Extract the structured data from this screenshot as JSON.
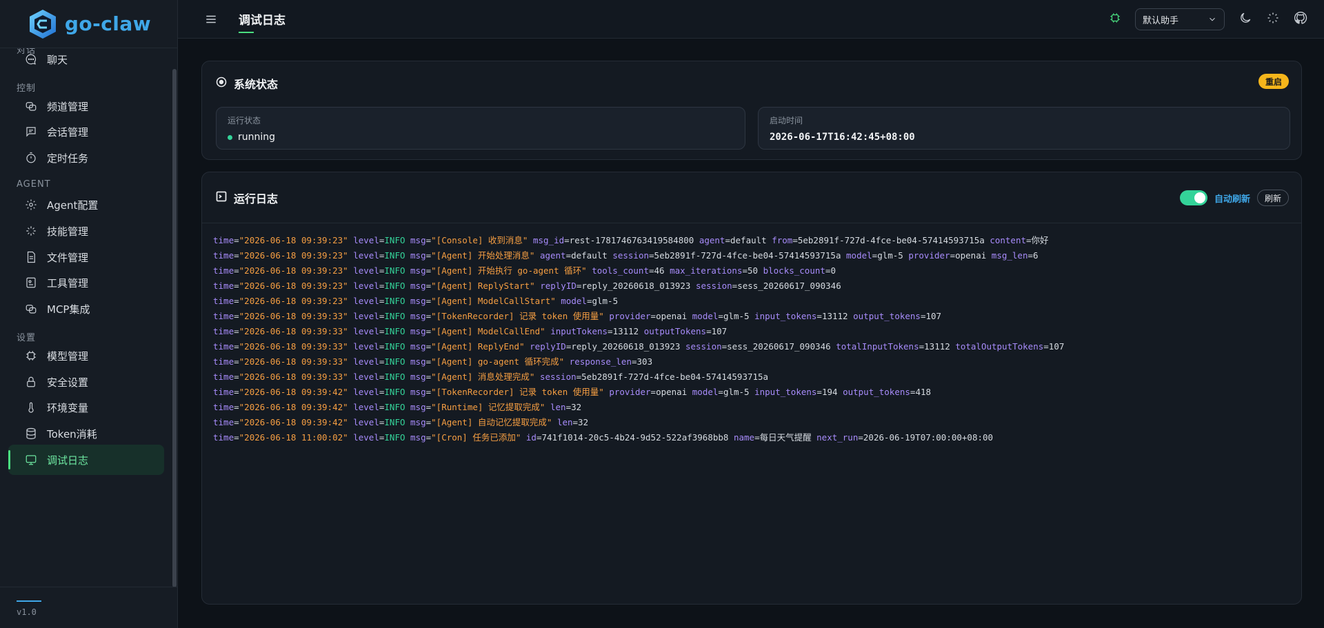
{
  "brand": {
    "name": "go-claw"
  },
  "sidebar": {
    "sections": [
      {
        "label": "对话"
      },
      {
        "label": "控制"
      },
      {
        "label": "AGENT"
      },
      {
        "label": "设置"
      }
    ],
    "items": [
      {
        "label": "聊天",
        "icon": "chat-icon"
      },
      {
        "label": "频道管理",
        "icon": "channels-icon"
      },
      {
        "label": "会话管理",
        "icon": "message-icon"
      },
      {
        "label": "定时任务",
        "icon": "timer-icon"
      },
      {
        "label": "Agent配置",
        "icon": "gear-icon"
      },
      {
        "label": "技能管理",
        "icon": "sparkle-icon"
      },
      {
        "label": "文件管理",
        "icon": "file-icon"
      },
      {
        "label": "工具管理",
        "icon": "tool-icon"
      },
      {
        "label": "MCP集成",
        "icon": "mcp-icon"
      },
      {
        "label": "模型管理",
        "icon": "chip-icon"
      },
      {
        "label": "安全设置",
        "icon": "lock-icon"
      },
      {
        "label": "环境变量",
        "icon": "thermometer-icon"
      },
      {
        "label": "Token消耗",
        "icon": "database-icon"
      },
      {
        "label": "调试日志",
        "icon": "monitor-icon",
        "active": true
      }
    ],
    "version": "v1.0"
  },
  "topbar": {
    "title": "调试日志",
    "agent_select": "默认助手"
  },
  "status": {
    "title": "系统状态",
    "restart": "重启",
    "run_label": "运行状态",
    "run_value": "running",
    "start_label": "启动时间",
    "start_value": "2026-06-17T16:42:45+08:00"
  },
  "logs": {
    "title": "运行日志",
    "auto_refresh": "自动刷新",
    "refresh": "刷新",
    "lines": [
      "time=\"2026-06-18 09:39:23\" level=INFO msg=\"[Console] 收到消息\" msg_id=rest-1781746763419584800 agent=default from=5eb2891f-727d-4fce-be04-57414593715a content=你好",
      "time=\"2026-06-18 09:39:23\" level=INFO msg=\"[Agent] 开始处理消息\" agent=default session=5eb2891f-727d-4fce-be04-57414593715a model=glm-5 provider=openai msg_len=6",
      "time=\"2026-06-18 09:39:23\" level=INFO msg=\"[Agent] 开始执行 go-agent 循环\" tools_count=46 max_iterations=50 blocks_count=0",
      "time=\"2026-06-18 09:39:23\" level=INFO msg=\"[Agent] ReplyStart\" replyID=reply_20260618_013923 session=sess_20260617_090346",
      "time=\"2026-06-18 09:39:23\" level=INFO msg=\"[Agent] ModelCallStart\" model=glm-5",
      "time=\"2026-06-18 09:39:33\" level=INFO msg=\"[TokenRecorder] 记录 token 使用量\" provider=openai model=glm-5 input_tokens=13112 output_tokens=107",
      "time=\"2026-06-18 09:39:33\" level=INFO msg=\"[Agent] ModelCallEnd\" inputTokens=13112 outputTokens=107",
      "time=\"2026-06-18 09:39:33\" level=INFO msg=\"[Agent] ReplyEnd\" replyID=reply_20260618_013923 session=sess_20260617_090346 totalInputTokens=13112 totalOutputTokens=107",
      "time=\"2026-06-18 09:39:33\" level=INFO msg=\"[Agent] go-agent 循环完成\" response_len=303",
      "time=\"2026-06-18 09:39:33\" level=INFO msg=\"[Agent] 消息处理完成\" session=5eb2891f-727d-4fce-be04-57414593715a",
      "time=\"2026-06-18 09:39:42\" level=INFO msg=\"[TokenRecorder] 记录 token 使用量\" provider=openai model=glm-5 input_tokens=194 output_tokens=418",
      "time=\"2026-06-18 09:39:42\" level=INFO msg=\"[Runtime] 记忆提取完成\" len=32",
      "time=\"2026-06-18 09:39:42\" level=INFO msg=\"[Agent] 自动记忆提取完成\" len=32",
      "time=\"2026-06-18 11:00:02\" level=INFO msg=\"[Cron] 任务已添加\" id=741f1014-20c5-4b24-9d52-522af3968bb8 name=每日天气提醒 next_run=2026-06-19T07:00:00+08:00"
    ]
  },
  "colors": {
    "accent_green": "#4ade80",
    "accent_blue": "#3fa7e8",
    "restart_yellow": "#f5b51b",
    "log_key": "#a78bfa",
    "log_string": "#f59e42",
    "log_level": "#34d399"
  }
}
